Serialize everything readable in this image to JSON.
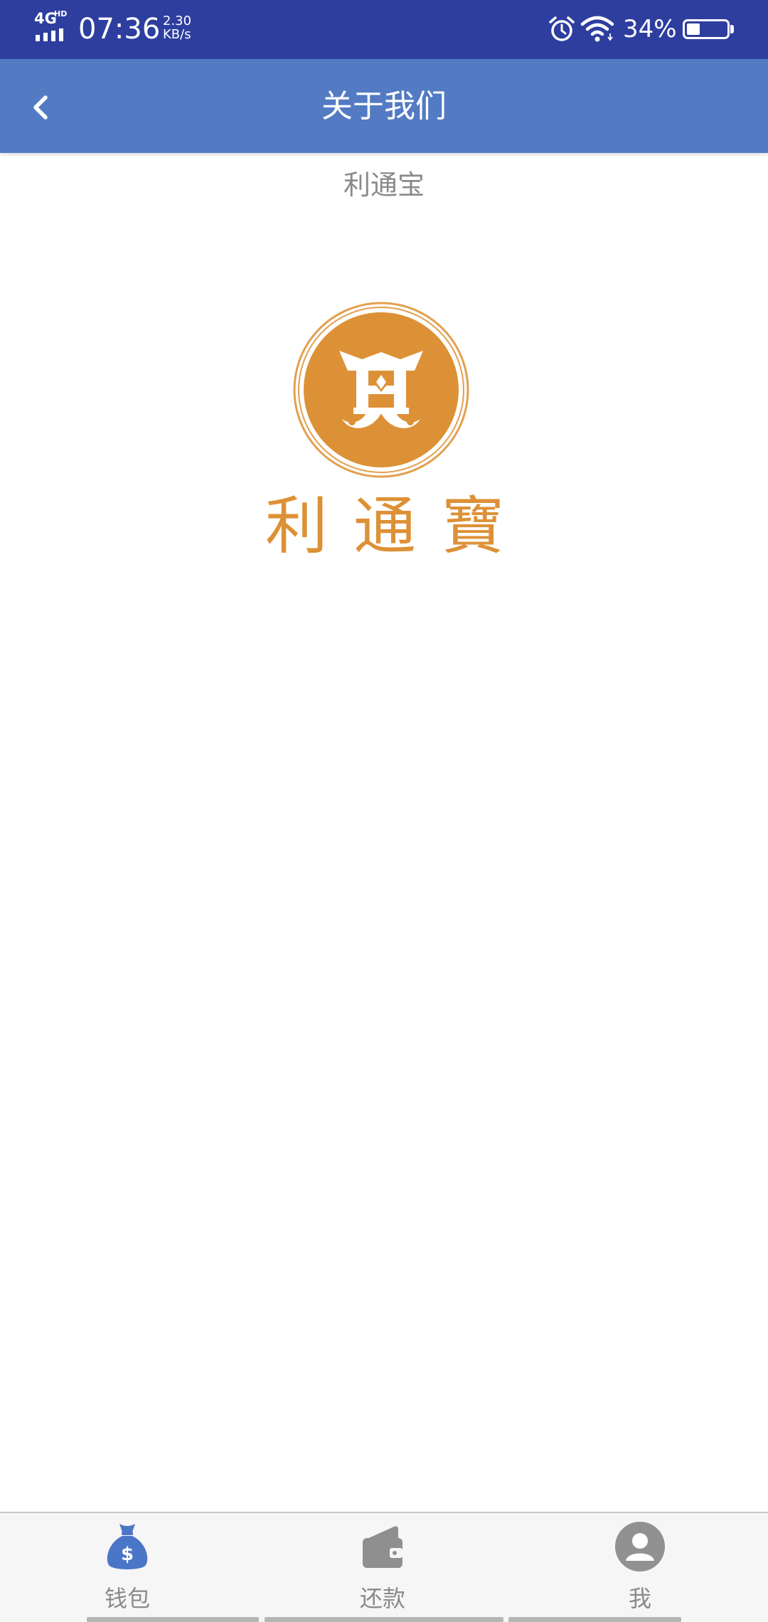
{
  "status_bar": {
    "network": "4G",
    "hd": "HD",
    "time": "07:36",
    "speed": "2.30",
    "speed_unit": "KB/s",
    "battery": "34%",
    "battery_level": 0.34,
    "icons": [
      "signal-icon",
      "alarm-icon",
      "wifi-icon",
      "battery-icon"
    ]
  },
  "header": {
    "title": "关于我们",
    "back_icon": "chevron-left-icon"
  },
  "app_name": "利通宝",
  "logo": {
    "icon": "litongbao-logo",
    "text": "利 通 寶"
  },
  "tabs": [
    {
      "label": "钱包",
      "icon": "money-bag-icon",
      "active": true
    },
    {
      "label": "还款",
      "icon": "wallet-icon",
      "active": false
    },
    {
      "label": "我",
      "icon": "person-icon",
      "active": false
    }
  ],
  "colors": {
    "status_bar": "#2e3e9f",
    "header": "#537bc4",
    "active_tab_icon": "#4b76c8",
    "inactive_tab_icon": "#8f8f8f",
    "logo": "#dd9136",
    "app_name_text": "#8a8a8a",
    "tab_label": "#8a8a8a"
  }
}
